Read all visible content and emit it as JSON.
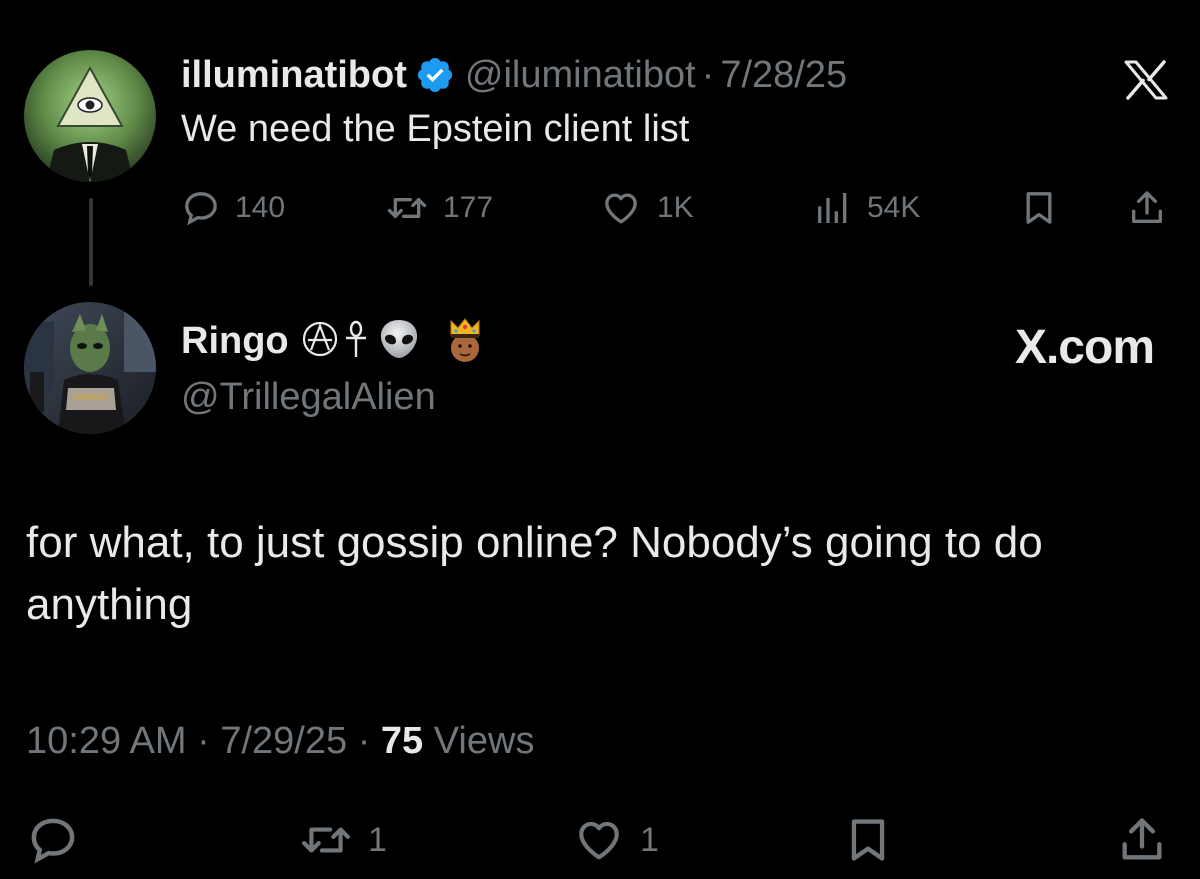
{
  "parent_tweet": {
    "display_name": "illuminatibot",
    "verified": true,
    "handle": "@iluminatibot",
    "date": "7/28/25",
    "text": "We need the Epstein client list",
    "avatar_icon": "all-seeing-eye-suit-avatar",
    "metrics": {
      "replies": "140",
      "reposts": "177",
      "likes": "1K",
      "views": "54K"
    }
  },
  "reply_tweet": {
    "display_name": "Ringo",
    "name_emojis": [
      "anarchy-symbol",
      "ankh-symbol",
      "alien-emoji",
      "crowned-man-emoji"
    ],
    "handle": "@TrillegalAlien",
    "avatar_icon": "alien-figure-photo-avatar",
    "text": "for what, to just gossip online? Nobody’s going to do anything",
    "time": "10:29 AM",
    "date": "7/29/25",
    "views_count": "75",
    "views_label": "Views",
    "metrics": {
      "reposts": "1",
      "likes": "1"
    }
  },
  "watermark": {
    "brand_label": "X.com"
  },
  "separator": "·",
  "colors": {
    "background": "#000000",
    "primary_text": "#e7e9ea",
    "secondary_text": "#71767b",
    "verified_blue": "#1d9bf0"
  }
}
